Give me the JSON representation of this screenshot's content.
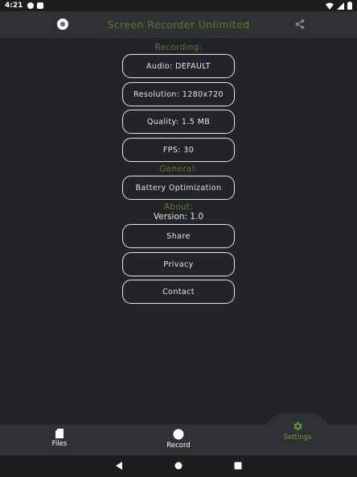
{
  "status_bar": {
    "time": "4:21"
  },
  "app_bar": {
    "title": "Screen Recorder Unlimited"
  },
  "sections": {
    "recording": "Recording:",
    "general": "General:",
    "about": "About:"
  },
  "recording_buttons": {
    "audio": "Audio: DEFAULT",
    "resolution": "Resolution: 1280x720",
    "quality": "Quality: 1.5 MB",
    "fps": "FPS: 30"
  },
  "general_buttons": {
    "battery": "Battery Optimization"
  },
  "about": {
    "version": "Version: 1.0",
    "share": "Share",
    "privacy": "Privacy",
    "contact": "Contact"
  },
  "bottom_nav": {
    "files": "Files",
    "record": "Record",
    "settings": "Settings"
  },
  "colors": {
    "accent": "#5a7a2c",
    "active_tab": "#5fa02d",
    "background": "#222427",
    "bar": "#303134"
  },
  "icons": {
    "app_logo": "record-dot-icon",
    "share": "share-icon",
    "files": "sd-card-icon",
    "record": "circle-icon",
    "settings": "gear-icon"
  }
}
